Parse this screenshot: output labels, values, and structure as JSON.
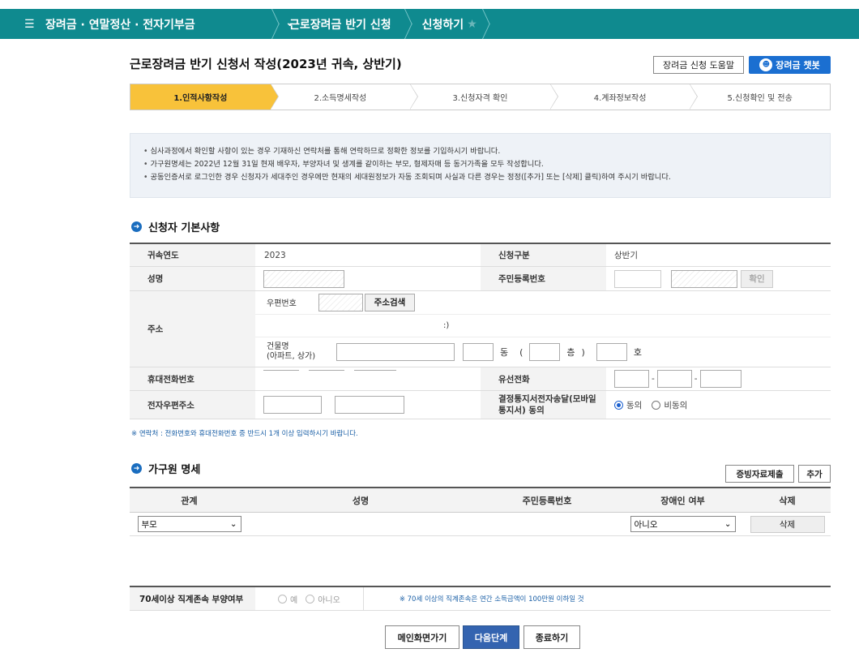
{
  "topbar": {
    "menu": "장려금 · 연말정산 · 전자기부금",
    "crumb2": "근로장려금 반기 신청",
    "crumb3": "신청하기"
  },
  "title": "근로장려금 반기 신청서 작성(2023년 귀속, 상반기)",
  "help_button": "장려금 신청 도움말",
  "chatbot_button": "장려금 챗봇",
  "steps": [
    "1.인적사항작성",
    "2.소득명세작성",
    "3.신청자격 확인",
    "4.계좌정보작성",
    "5.신청확인 및 전송"
  ],
  "notice": [
    "심사과정에서 확인할 사항이 있는 경우 기재하신 연락처를 통해 연락하므로 정확한 정보를 기입하시기 바랍니다.",
    "가구원명세는 2022년 12월 31일 현재 배우자, 부양자녀 및 생계를 같이하는 부모, 형제자매 등 동거가족을 모두 작성합니다.",
    "공동인증서로 로그인한 경우 신청자가 세대주인 경우에만 현재의 세대원정보가 자동 조회되며 사실과 다른 경우는 정정([추가] 또는 [삭제] 클릭)하여 주시기 바랍니다."
  ],
  "section1": "신청자 기본사항",
  "form": {
    "year_label": "귀속연도",
    "year_value": "2023",
    "type_label": "신청구분",
    "type_value": "상반기",
    "name_label": "성명",
    "rrn_label": "주민등록번호",
    "confirm_btn": "확인",
    "address_label": "주소",
    "zip_label": "우편번호",
    "zip_search_btn": "주소검색",
    "address_paren": ":)",
    "building_label": "건물명",
    "building_sub": "(아파트, 상가)",
    "dong": "동",
    "floor_open": "(",
    "floor": "층",
    "floor_close": ")",
    "ho": "호",
    "mobile_label": "휴대전화번호",
    "landline_label": "유선전화",
    "dash": "-",
    "email_label": "전자우편주소",
    "consent_label": "결정통지서전자송달(모바일 통지서) 동의",
    "agree": "동의",
    "disagree": "비동의"
  },
  "contact_note": "※ 연락처 : 전화번호와 휴대전화번호 중 반드시 1개 이상 입력하시기 바랍니다.",
  "section2": "가구원 명세",
  "proof_button": "증빙자료제출",
  "add_button": "추가",
  "family_headers": [
    "관계",
    "성명",
    "주민등록번호",
    "장애인 여부",
    "삭제"
  ],
  "family_row": {
    "relation": "부모",
    "disabled": "아니오",
    "delete": "삭제"
  },
  "elder": {
    "label": "70세이상 직계존속 부양여부",
    "yes": "예",
    "no": "아니오",
    "note": "※ 70세 이상의 직계존속은 연간 소득금액이 100만원 이하일 것"
  },
  "buttons": {
    "main": "메인화면가기",
    "next": "다음단계",
    "exit": "종료하기"
  }
}
